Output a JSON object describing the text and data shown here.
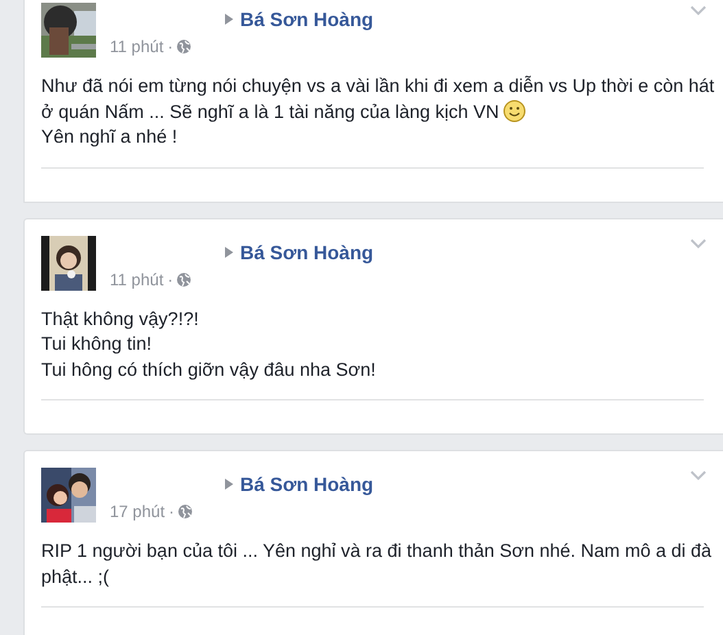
{
  "posts": [
    {
      "author": "Bá Sơn Hoàng",
      "time": "11 phút",
      "separator": "·",
      "lines": [
        {
          "text": "Như đã nói em từng nói chuyện vs a vài lần khi đi xem a diễn vs Up thời e còn hát ở quán Nấm ... Sẽ nghĩ a là 1 tài năng của làng kịch VN",
          "smiley": true
        },
        {
          "text": "Yên nghĩ a nhé !"
        }
      ]
    },
    {
      "author": "Bá Sơn Hoàng",
      "time": "11 phút",
      "separator": "·",
      "lines": [
        {
          "text": "Thật không vậy?!?!"
        },
        {
          "text": "Tui không tin!"
        },
        {
          "text": "Tui hông có thích giỡn vậy đâu nha Sơn!"
        }
      ]
    },
    {
      "author": "Bá Sơn Hoàng",
      "time": "17 phút",
      "separator": "·",
      "lines": [
        {
          "text": "RIP 1 người bạn của tôi ... Yên nghỉ và ra đi thanh thản Sơn nhé. Nam mô a di đà phật... ;("
        }
      ]
    }
  ]
}
